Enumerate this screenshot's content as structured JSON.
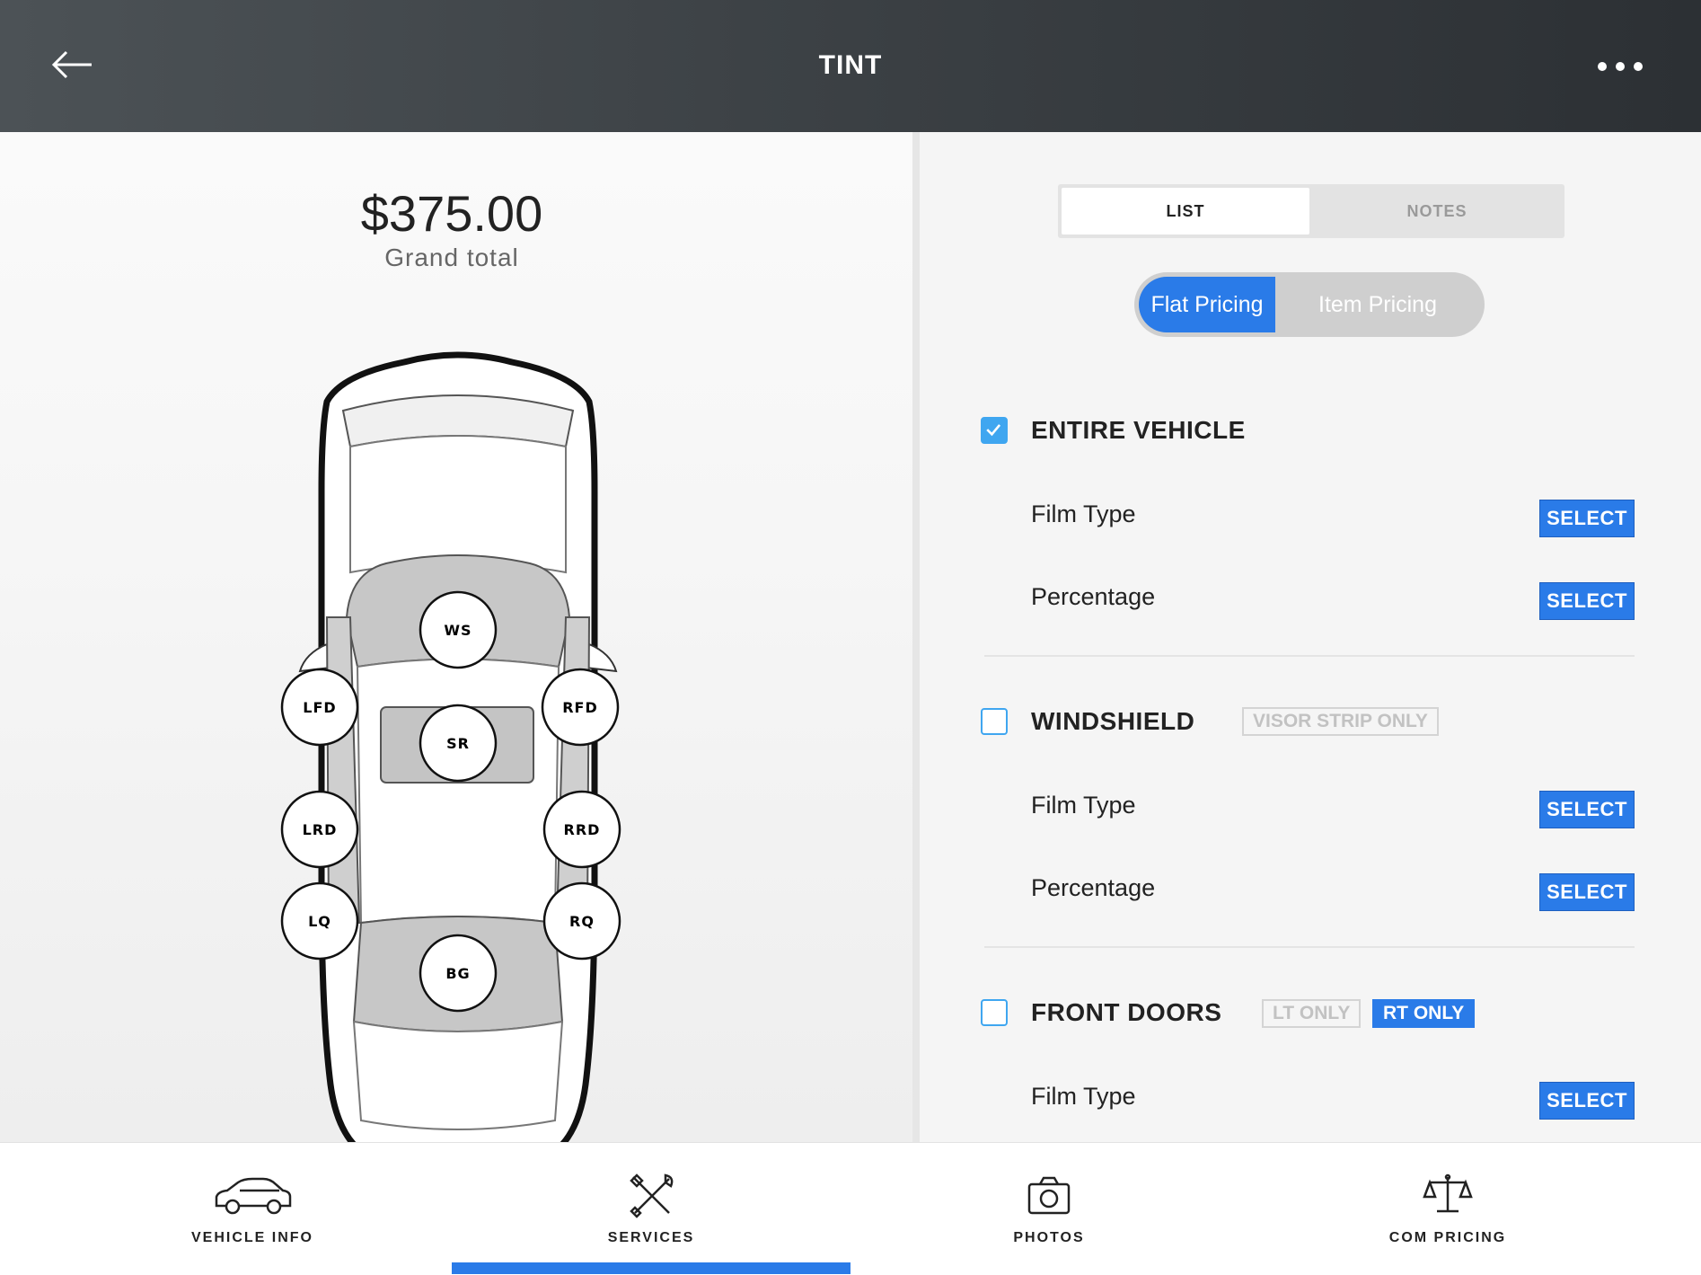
{
  "header": {
    "title": "TINT",
    "back_icon": "arrow-left-icon",
    "more_icon": "more-horizontal-icon"
  },
  "summary": {
    "total": "$375.00",
    "total_label": "Grand total"
  },
  "car_zones": [
    "WS",
    "LFD",
    "RFD",
    "SR",
    "LRD",
    "RRD",
    "LQ",
    "RQ",
    "BG"
  ],
  "tabs": [
    {
      "label": "LIST",
      "active": true
    },
    {
      "label": "NOTES",
      "active": false
    }
  ],
  "pricing_toggle": {
    "options": [
      "Flat Pricing",
      "Item Pricing"
    ],
    "selected": "Flat Pricing"
  },
  "sections": [
    {
      "title": "ENTIRE VEHICLE",
      "checked": true,
      "tags": [],
      "rows": [
        {
          "label": "Film Type",
          "button": "SELECT"
        },
        {
          "label": "Percentage",
          "button": "SELECT"
        }
      ]
    },
    {
      "title": "WINDSHIELD",
      "checked": false,
      "tags": [
        {
          "label": "VISOR STRIP ONLY",
          "active": false
        }
      ],
      "rows": [
        {
          "label": "Film Type",
          "button": "SELECT"
        },
        {
          "label": "Percentage",
          "button": "SELECT"
        }
      ]
    },
    {
      "title": "FRONT DOORS",
      "checked": false,
      "tags": [
        {
          "label": "LT ONLY",
          "active": false
        },
        {
          "label": "RT ONLY",
          "active": true
        }
      ],
      "rows": [
        {
          "label": "Film Type",
          "button": "SELECT"
        }
      ]
    }
  ],
  "bottom_nav": [
    {
      "label": "VEHICLE INFO",
      "icon": "car-icon",
      "active": false
    },
    {
      "label": "SERVICES",
      "icon": "tools-icon",
      "active": true
    },
    {
      "label": "PHOTOS",
      "icon": "camera-icon",
      "active": false
    },
    {
      "label": "COM PRICING",
      "icon": "scale-icon",
      "active": false
    }
  ],
  "colors": {
    "accent": "#2a7be8",
    "checkbox": "#3fa6f0",
    "header_dark": "#2c3034"
  }
}
